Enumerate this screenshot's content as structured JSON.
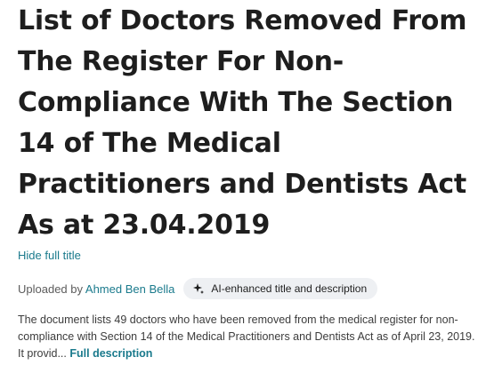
{
  "document": {
    "title": "List of Doctors Removed From The Register For Non-Compliance With The Section 14 of The Medical Practitioners and Dentists Act As at 23.04.2019",
    "hide_title_label": "Hide full title"
  },
  "meta": {
    "uploaded_by_prefix": "Uploaded by",
    "uploader_name": "Ahmed Ben Bella",
    "ai_badge_label": "AI-enhanced title and description",
    "ai_badge_icon": "sparkle-icon"
  },
  "description": {
    "text": "The document lists 49 doctors who have been removed from the medical register for non-compliance with Section 14 of the Medical Practitioners and Dentists Act as of April 23, 2019. It provid...",
    "full_description_link": "Full description"
  },
  "colors": {
    "accent": "#1a7a8c",
    "title_text": "#1e1e1e",
    "pill_background": "#eef0f3"
  }
}
